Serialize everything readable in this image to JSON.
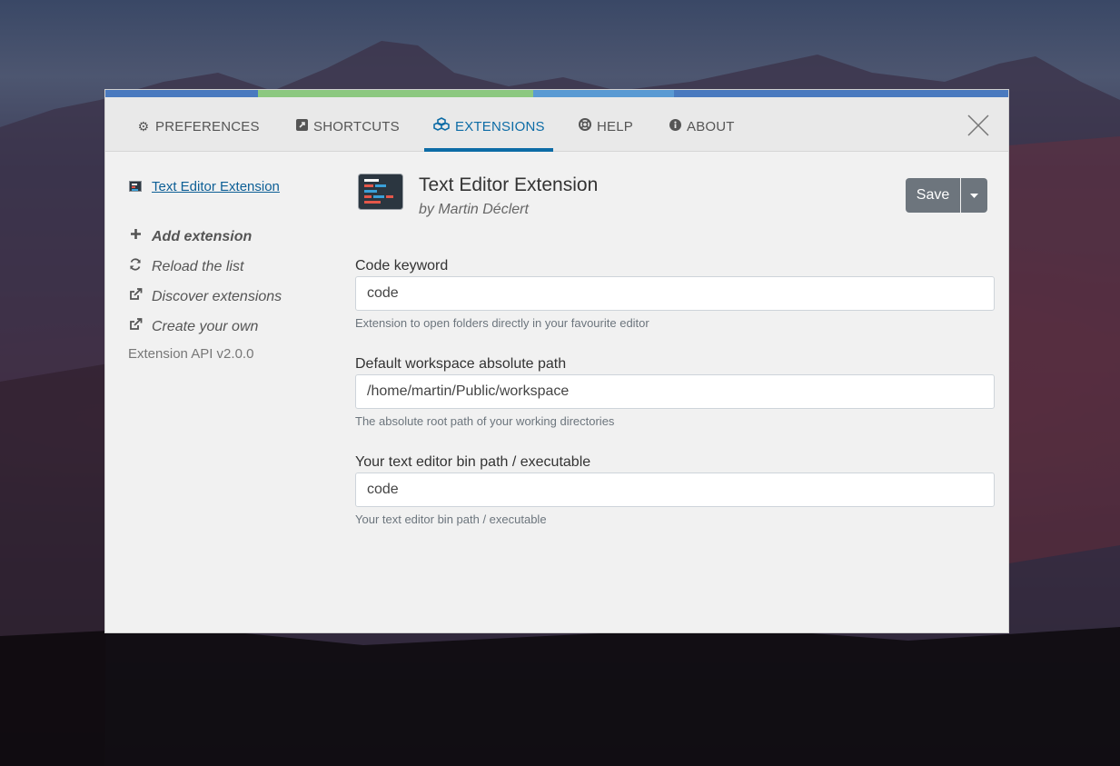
{
  "colors": {
    "accent": "#0d6ca6",
    "topbar_segments": [
      "#4a7abf",
      "#8cc880",
      "#5a9ad3",
      "#4a7abf"
    ],
    "save_button": "#6d757d"
  },
  "tabs": [
    {
      "label": "PREFERENCES",
      "icon": "gear-icon",
      "active": false
    },
    {
      "label": "SHORTCUTS",
      "icon": "external-square-icon",
      "active": false
    },
    {
      "label": "EXTENSIONS",
      "icon": "cubes-icon",
      "active": true
    },
    {
      "label": "HELP",
      "icon": "life-ring-icon",
      "active": false
    },
    {
      "label": "ABOUT",
      "icon": "info-circle-icon",
      "active": false
    }
  ],
  "sidebar": {
    "extension": {
      "label": "Text Editor Extension",
      "icon": "code-editor-icon"
    },
    "links": [
      {
        "label": "Add extension",
        "icon": "plus-icon"
      },
      {
        "label": "Reload the list",
        "icon": "refresh-icon"
      },
      {
        "label": "Discover extensions",
        "icon": "external-link-icon"
      },
      {
        "label": "Create your own",
        "icon": "external-link-icon"
      }
    ],
    "api_version": "Extension API v2.0.0"
  },
  "extension": {
    "title": "Text Editor Extension",
    "author": "by Martin Déclert",
    "save_label": "Save",
    "dropdown_icon": "caret-down-icon"
  },
  "fields": [
    {
      "label": "Code keyword",
      "value": "code",
      "help": "Extension to open folders directly in your favourite editor"
    },
    {
      "label": "Default workspace absolute path",
      "value": "/home/martin/Public/workspace",
      "help": "The absolute root path of your working directories"
    },
    {
      "label": "Your text editor bin path / executable",
      "value": "code",
      "help": "Your text editor bin path / executable"
    }
  ]
}
